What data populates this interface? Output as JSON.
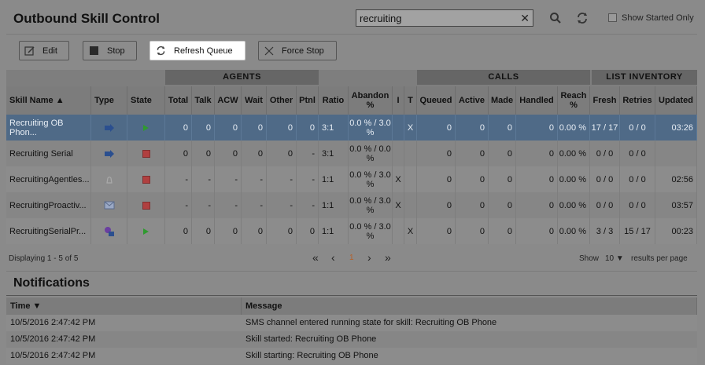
{
  "header": {
    "title": "Outbound Skill Control",
    "search_value": "recruiting",
    "search_clear": "✕",
    "show_started_label": "Show Started Only"
  },
  "toolbar": {
    "edit_label": "Edit",
    "stop_label": "Stop",
    "refresh_label": "Refresh Queue",
    "force_stop_label": "Force Stop"
  },
  "grid": {
    "groups": {
      "agents": "AGENTS",
      "calls": "CALLS",
      "list_inventory": "LIST INVENTORY"
    },
    "columns": {
      "skill_name": "Skill Name ▲",
      "type": "Type",
      "state": "State",
      "total": "Total",
      "talk": "Talk",
      "acw": "ACW",
      "wait": "Wait",
      "other": "Other",
      "ptnl": "Ptnl",
      "ratio": "Ratio",
      "abandon": "Abandon %",
      "i": "I",
      "t": "T",
      "queued": "Queued",
      "active": "Active",
      "made": "Made",
      "handled": "Handled",
      "reach": "Reach %",
      "fresh": "Fresh",
      "retries": "Retries",
      "updated": "Updated"
    },
    "rows": [
      {
        "name": "Recruiting OB Phon...",
        "type_icon": "phone-outbound-icon",
        "state": "running",
        "total": "0",
        "talk": "0",
        "acw": "0",
        "wait": "0",
        "other": "0",
        "ptnl": "0",
        "ratio": "3:1",
        "abandon": "0.0 % / 3.0 %",
        "i": "",
        "t": "X",
        "queued": "0",
        "active": "0",
        "made": "0",
        "handled": "0",
        "reach": "0.00 %",
        "fresh": "17 / 17",
        "retries": "0 / 0",
        "updated": "03:26"
      },
      {
        "name": "Recruiting Serial",
        "type_icon": "phone-outbound-icon",
        "state": "stopped",
        "total": "0",
        "talk": "0",
        "acw": "0",
        "wait": "0",
        "other": "0",
        "ptnl": "-",
        "ratio": "3:1",
        "abandon": "0.0 % / 0.0 %",
        "i": "",
        "t": "",
        "queued": "0",
        "active": "0",
        "made": "0",
        "handled": "0",
        "reach": "0.00 %",
        "fresh": "0 / 0",
        "retries": "0 / 0",
        "updated": ""
      },
      {
        "name": "RecruitingAgentles...",
        "type_icon": "agentless-icon",
        "state": "stopped",
        "total": "-",
        "talk": "-",
        "acw": "-",
        "wait": "-",
        "other": "-",
        "ptnl": "-",
        "ratio": "1:1",
        "abandon": "0.0 % / 3.0 %",
        "i": "X",
        "t": "",
        "queued": "0",
        "active": "0",
        "made": "0",
        "handled": "0",
        "reach": "0.00 %",
        "fresh": "0 / 0",
        "retries": "0 / 0",
        "updated": "02:56"
      },
      {
        "name": "RecruitingProactiv...",
        "type_icon": "email-icon",
        "state": "stopped",
        "total": "-",
        "talk": "-",
        "acw": "-",
        "wait": "-",
        "other": "-",
        "ptnl": "-",
        "ratio": "1:1",
        "abandon": "0.0 % / 3.0 %",
        "i": "X",
        "t": "",
        "queued": "0",
        "active": "0",
        "made": "0",
        "handled": "0",
        "reach": "0.00 %",
        "fresh": "0 / 0",
        "retries": "0 / 0",
        "updated": "03:57"
      },
      {
        "name": "RecruitingSerialPr...",
        "type_icon": "serial-proactive-icon",
        "state": "running",
        "total": "0",
        "talk": "0",
        "acw": "0",
        "wait": "0",
        "other": "0",
        "ptnl": "0",
        "ratio": "1:1",
        "abandon": "0.0 % / 3.0 %",
        "i": "",
        "t": "X",
        "queued": "0",
        "active": "0",
        "made": "0",
        "handled": "0",
        "reach": "0.00 %",
        "fresh": "3 / 3",
        "retries": "15 / 17",
        "updated": "00:23"
      }
    ]
  },
  "paging": {
    "displaying": "Displaying 1 - 5 of 5",
    "first": "«",
    "prev": "‹",
    "current_page": "1",
    "next": "›",
    "last": "»",
    "show_label": "Show",
    "page_size": "10 ▼",
    "per_page_label": "results per page"
  },
  "notifications": {
    "title": "Notifications",
    "col_time": "Time ▼",
    "col_message": "Message",
    "rows": [
      {
        "time": "10/5/2016 2:47:42 PM",
        "message": "SMS channel entered running state for skill: Recruiting OB Phone"
      },
      {
        "time": "10/5/2016 2:47:42 PM",
        "message": "Skill started: Recruiting OB Phone"
      },
      {
        "time": "10/5/2016 2:47:42 PM",
        "message": "Skill starting: Recruiting OB Phone"
      }
    ]
  }
}
